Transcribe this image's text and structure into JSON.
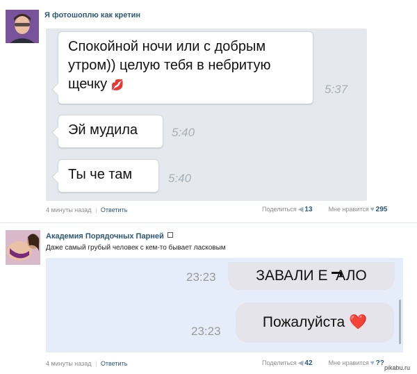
{
  "post1": {
    "author": "Я фотошоплю как кретин",
    "messages": [
      {
        "text": "Спокойной ночи или с добрым утром)) целую тебя в небритую щечку",
        "emoji": "💋",
        "time": "5:37"
      },
      {
        "text": "Эй мудила",
        "time": "5:40"
      },
      {
        "text": "Ты че там",
        "time": "5:40"
      }
    ],
    "footer": {
      "time": "4 минуты назад",
      "device_icon": "apple-icon",
      "reply": "Ответить",
      "share_label": "Поделиться",
      "share_count": "13",
      "like_label": "Мне нравится",
      "like_count": "295"
    }
  },
  "post2": {
    "author": "Академия Порядочных Парней",
    "author_icon": "box-icon",
    "caption": "Даже самый грубый человек с кем-то бывает ласковым",
    "messages": [
      {
        "text": "ЗАВАЛИ Е  АЛО",
        "time": "23:23"
      },
      {
        "text": "Пожалуйста",
        "emoji": "❤️",
        "time": "23:23"
      }
    ],
    "footer": {
      "time": "4 минуты назад",
      "reply": "Ответить",
      "share_label": "Поделиться",
      "share_count": "42",
      "like_label": "Мне нравится",
      "like_count": "??"
    }
  },
  "watermark": "pikabu.ru",
  "colors": {
    "link": "#2b587a",
    "vk_chat_bg": "#e5e9ee",
    "ios_chat_bg": "#e4edf9",
    "ios_bubble": "#e4e4ea"
  }
}
